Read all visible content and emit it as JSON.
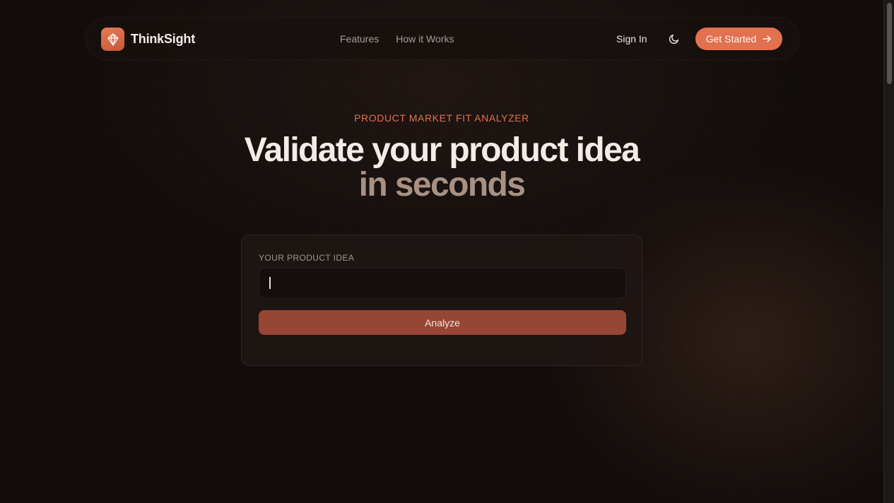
{
  "nav": {
    "brand_name": "ThinkSight",
    "links": [
      {
        "label": "Features"
      },
      {
        "label": "How it Works"
      }
    ],
    "sign_in": "Sign In",
    "cta_label": "Get Started",
    "icons": {
      "logo": "diamond-logo-icon",
      "theme": "moon-icon",
      "cta": "arrow-right-icon"
    }
  },
  "hero": {
    "eyebrow": "PRODUCT MARKET FIT ANALYZER",
    "headline_line1": "Validate your product idea",
    "headline_line2": "in seconds"
  },
  "form": {
    "label": "YOUR PRODUCT IDEA",
    "input_value": "",
    "input_placeholder": "",
    "submit_label": "Analyze"
  },
  "colors": {
    "accent": "#e2714f",
    "button": "#974635",
    "background": "#120d0b"
  }
}
